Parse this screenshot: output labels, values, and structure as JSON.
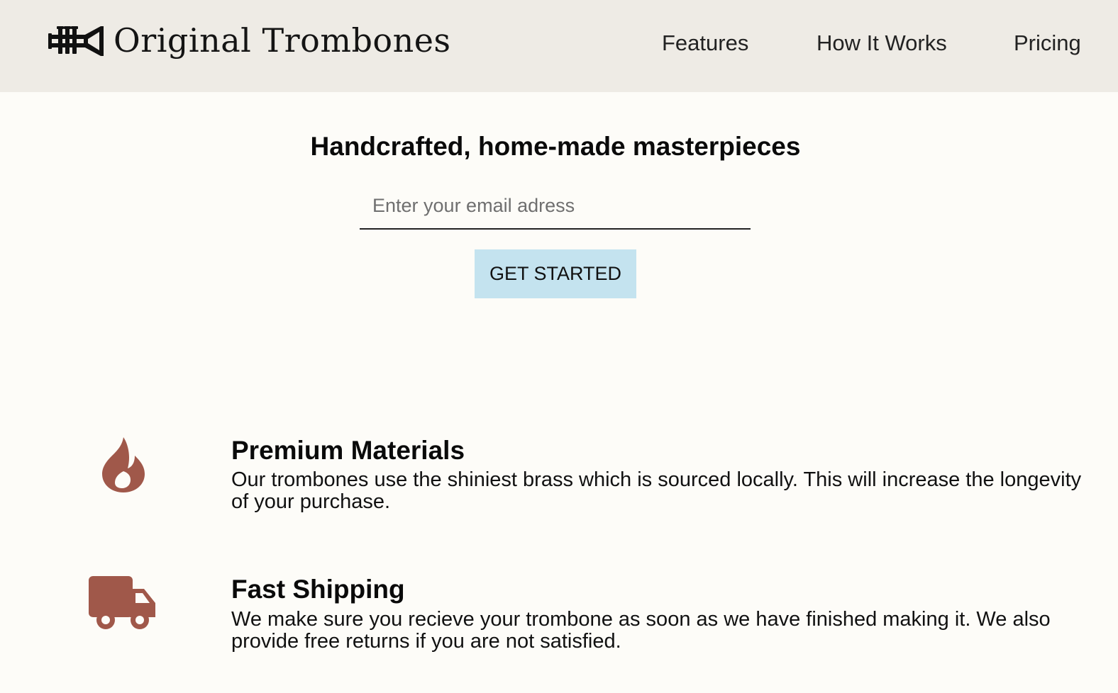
{
  "header": {
    "brand": "Original Trombones",
    "logo_icon": "trumpet-icon",
    "nav": {
      "features": "Features",
      "how_it_works": "How It Works",
      "pricing": "Pricing"
    }
  },
  "hero": {
    "title": "Handcrafted, home-made masterpieces",
    "email_placeholder": "Enter your email adress",
    "email_value": "",
    "cta_label": "GET STARTED"
  },
  "features": [
    {
      "icon": "fire-icon",
      "title": "Premium Materials",
      "description": "Our trombones use the shiniest brass which is sourced locally. This will increase the longevity of your purchase."
    },
    {
      "icon": "truck-icon",
      "title": "Fast Shipping",
      "description": "We make sure you recieve your trombone as soon as we have finished making it. We also provide free returns if you are not satisfied."
    }
  ],
  "colors": {
    "header_bg": "#eeebe5",
    "page_bg": "#fdfcf8",
    "accent": "#a0584a",
    "button_bg": "#c4e3ef"
  }
}
